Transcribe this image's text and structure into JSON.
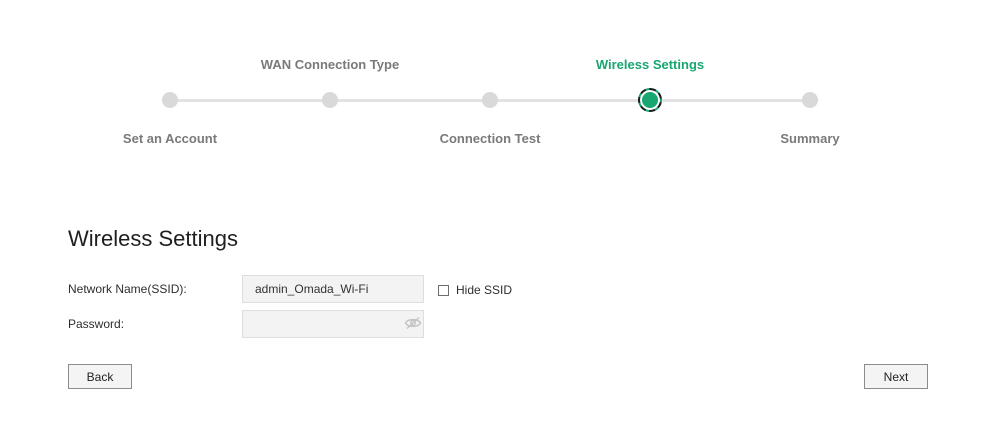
{
  "stepper": {
    "steps": [
      {
        "label": "Set an Account",
        "state": "done"
      },
      {
        "label": "WAN Connection Type",
        "state": "done"
      },
      {
        "label": "Connection Test",
        "state": "done"
      },
      {
        "label": "Wireless Settings",
        "state": "current"
      },
      {
        "label": "Summary",
        "state": "upcoming"
      }
    ],
    "active_color": "#19a671",
    "inactive_color": "#d9d9d9"
  },
  "form": {
    "title": "Wireless Settings",
    "ssid_label": "Network Name(SSID):",
    "ssid_value": "admin_Omada_Wi-Fi",
    "hide_ssid_label": "Hide SSID",
    "hide_ssid_checked": false,
    "password_label": "Password:",
    "password_value": "",
    "password_visibility_icon": "eye-off-icon"
  },
  "buttons": {
    "back_label": "Back",
    "next_label": "Next"
  }
}
